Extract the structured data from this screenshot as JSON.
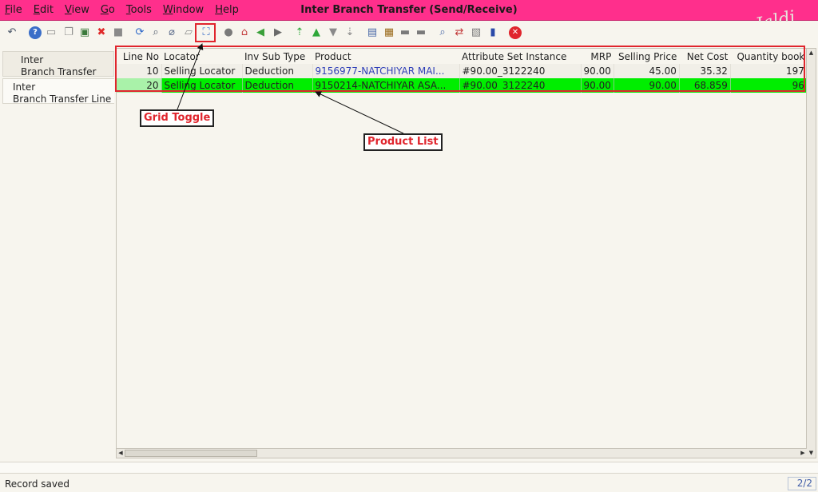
{
  "window": {
    "title": "Inter Branch Transfer (Send/Receive)",
    "brand": "Jaldi",
    "menus": [
      "File",
      "Edit",
      "View",
      "Go",
      "Tools",
      "Window",
      "Help"
    ]
  },
  "toolbar": {
    "icons": [
      {
        "name": "undo-icon",
        "glyph": "↶",
        "color": "#4a5668",
        "shape": "plain"
      },
      {
        "name": "help-icon",
        "glyph": "?",
        "color": "#3a6ec8",
        "shape": "round"
      },
      {
        "name": "new-record-icon",
        "glyph": "▭",
        "color": "#8a8a8a",
        "shape": "plain"
      },
      {
        "name": "copy-record-icon",
        "glyph": "❐",
        "color": "#8a8a8a",
        "shape": "plain"
      },
      {
        "name": "save-record-icon",
        "glyph": "▣",
        "color": "#3b7a3b",
        "shape": "plain"
      },
      {
        "name": "delete-icon",
        "glyph": "✖",
        "color": "#e02a2a",
        "shape": "plain"
      },
      {
        "name": "save-icon",
        "glyph": "■",
        "color": "#8a8a8a",
        "shape": "plain"
      },
      {
        "name": "refresh-icon",
        "glyph": "⟳",
        "color": "#2a66c8",
        "shape": "plain"
      },
      {
        "name": "find-icon",
        "glyph": "⌕",
        "color": "#556070",
        "shape": "plain"
      },
      {
        "name": "attachment-icon",
        "glyph": "⌀",
        "color": "#5a6a8a",
        "shape": "plain"
      },
      {
        "name": "chat-icon",
        "glyph": "▱",
        "color": "#8a8a8a",
        "shape": "plain"
      },
      {
        "name": "grid-toggle-icon",
        "glyph": "⛶",
        "color": "#3a6ec8",
        "shape": "plain"
      },
      {
        "name": "history-icon",
        "glyph": "●",
        "color": "#7a7a7a",
        "shape": "plain"
      },
      {
        "name": "home-icon",
        "glyph": "⌂",
        "color": "#c23a3a",
        "shape": "plain"
      },
      {
        "name": "back-icon",
        "glyph": "◀",
        "color": "#3aa03a",
        "shape": "plain"
      },
      {
        "name": "forward-icon",
        "glyph": "▶",
        "color": "#6a6a6a",
        "shape": "plain"
      },
      {
        "name": "first-record-icon",
        "glyph": "⇡",
        "color": "#2fa83a",
        "shape": "plain"
      },
      {
        "name": "previous-record-icon",
        "glyph": "▲",
        "color": "#2fa83a",
        "shape": "plain"
      },
      {
        "name": "next-record-icon",
        "glyph": "▼",
        "color": "#8a8a8a",
        "shape": "plain"
      },
      {
        "name": "last-record-icon",
        "glyph": "⇣",
        "color": "#8a8a8a",
        "shape": "plain"
      },
      {
        "name": "report-icon",
        "glyph": "▤",
        "color": "#4a6aa8",
        "shape": "plain"
      },
      {
        "name": "archive-icon",
        "glyph": "▦",
        "color": "#9a6a1a",
        "shape": "plain"
      },
      {
        "name": "print-preview-icon",
        "glyph": "▬",
        "color": "#7a7a7a",
        "shape": "plain"
      },
      {
        "name": "print-icon",
        "glyph": "▬",
        "color": "#7a7a7a",
        "shape": "plain"
      },
      {
        "name": "zoom-across-icon",
        "glyph": "⌕",
        "color": "#4a6aa8",
        "shape": "plain"
      },
      {
        "name": "workflow-icon",
        "glyph": "⇄",
        "color": "#c23a3a",
        "shape": "plain"
      },
      {
        "name": "request-icon",
        "glyph": "▧",
        "color": "#7a7a7a",
        "shape": "plain"
      },
      {
        "name": "product-info-icon",
        "glyph": "▮",
        "color": "#2a4aa8",
        "shape": "plain"
      },
      {
        "name": "exit-icon",
        "glyph": "✕",
        "color": "#e0252d",
        "shape": "round"
      }
    ]
  },
  "tabs": [
    {
      "line1": "Inter",
      "line2": "Branch Transfer"
    },
    {
      "line1": "Inter",
      "line2": "Branch Transfer Line"
    }
  ],
  "grid": {
    "columns": [
      {
        "label": "Line No",
        "align": "num"
      },
      {
        "label": "Locator",
        "align": "text"
      },
      {
        "label": "Inv Sub Type",
        "align": "text"
      },
      {
        "label": "Product",
        "align": "text"
      },
      {
        "label": "Attribute Set Instance",
        "align": "text"
      },
      {
        "label": "MRP",
        "align": "num"
      },
      {
        "label": "Selling Price",
        "align": "num"
      },
      {
        "label": "Net Cost",
        "align": "num"
      },
      {
        "label": "Quantity book",
        "align": "num"
      }
    ],
    "rows": [
      [
        "10",
        "Selling Locator",
        "Deduction",
        "9156977-NATCHIYAR MAI...",
        "#90.00_3122240",
        "90.00",
        "45.00",
        "35.32",
        "197"
      ],
      [
        "20",
        "Selling Locator",
        "Deduction",
        "9150214-NATCHIYAR ASA...",
        "#90.00_3122240",
        "90.00",
        "90.00",
        "68.859",
        "96"
      ]
    ]
  },
  "annotations": {
    "grid_toggle": "Grid Toggle",
    "product_list": "Product List",
    "color": "#e0252d"
  },
  "status": {
    "message": "Record saved",
    "record_count": "2/2"
  }
}
